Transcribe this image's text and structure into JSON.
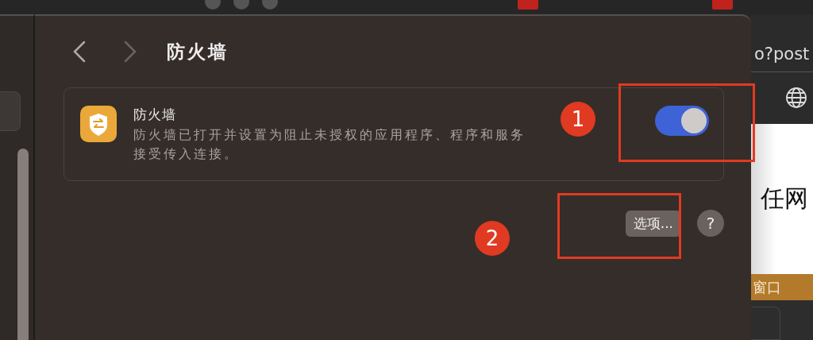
{
  "page": {
    "title": "防火墙",
    "back_enabled": true,
    "forward_enabled": false
  },
  "firewall": {
    "title": "防火墙",
    "description": "防火墙已打开并设置为阻止未授权的应用程序、程序和服务接受传入连接。",
    "on": true
  },
  "options_button": "选项...",
  "help_button": "?",
  "background_browser": {
    "address": "o?post",
    "page_text": "任网",
    "banner": "窗口"
  },
  "annotations": [
    {
      "number": "1"
    },
    {
      "number": "2"
    }
  ]
}
